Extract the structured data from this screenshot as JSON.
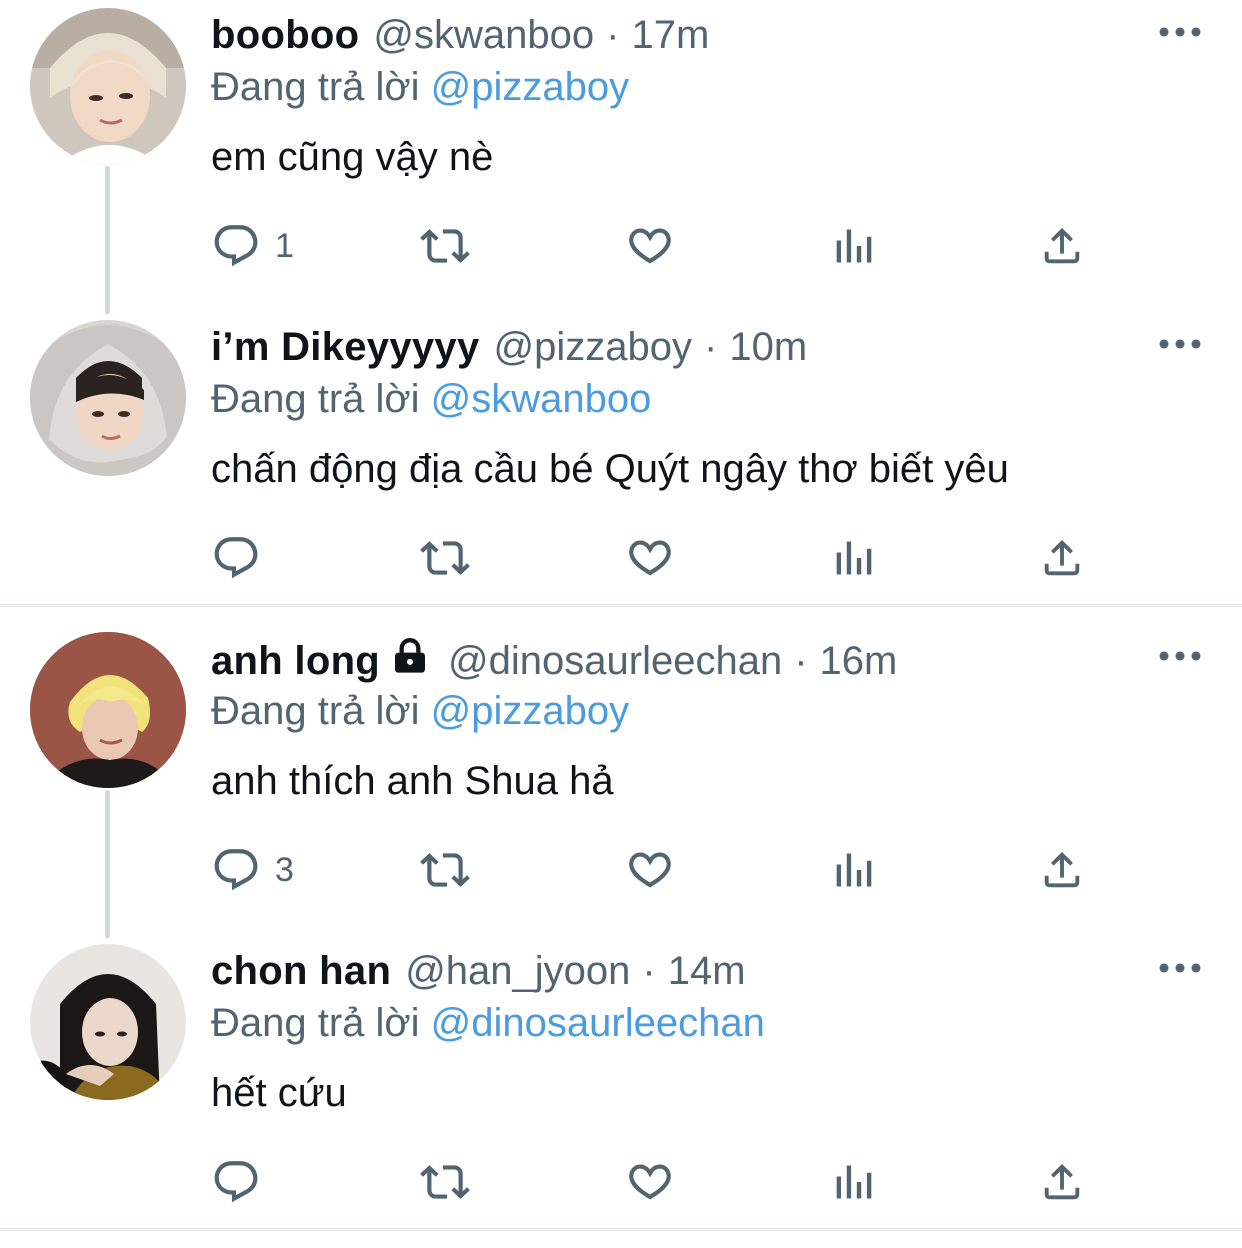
{
  "tweets": [
    {
      "name": "booboo",
      "handle": "@skwanboo",
      "sep": "·",
      "time": "17m",
      "replying_prefix": "Đang trả lời ",
      "replying_to": "@pizzaboy",
      "text": "em cũng vậy nè",
      "reply_count": "1",
      "locked": false
    },
    {
      "name": "i’m Dikeyyyyy",
      "handle": "@pizzaboy",
      "sep": "·",
      "time": "10m",
      "replying_prefix": "Đang trả lời ",
      "replying_to": "@skwanboo",
      "text": "chấn động địa cầu bé Quýt ngây thơ biết yêu",
      "reply_count": "",
      "locked": false
    },
    {
      "name": "anh long",
      "handle": "@dinosaurleechan",
      "sep": "·",
      "time": "16m",
      "replying_prefix": "Đang trả lời ",
      "replying_to": "@pizzaboy",
      "text": "anh thích anh Shua hả",
      "reply_count": "3",
      "locked": true
    },
    {
      "name": "chon han",
      "handle": "@han_jyoon",
      "sep": "·",
      "time": "14m",
      "replying_prefix": "Đang trả lời ",
      "replying_to": "@dinosaurleechan",
      "text": "hết cứu",
      "reply_count": "",
      "locked": false
    }
  ],
  "icons": {
    "reply": "reply-icon",
    "retweet": "retweet-icon",
    "like": "like-icon",
    "views": "views-icon",
    "share": "share-icon",
    "more": "more-icon",
    "lock": "lock-icon"
  },
  "colors": {
    "text": "#0f1419",
    "secondary": "#536471",
    "mention": "#4a9be0",
    "thread_line": "#cfd9de",
    "divider": "#e6ecf0"
  }
}
